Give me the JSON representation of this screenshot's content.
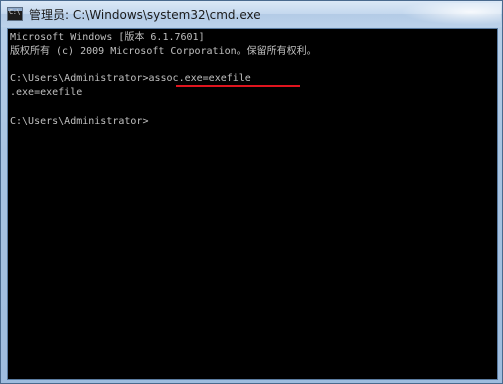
{
  "window": {
    "title": "管理员: C:\\Windows\\system32\\cmd.exe",
    "icon": "cmd-console-icon",
    "icon_label": "C:\\"
  },
  "console": {
    "lines": [
      "Microsoft Windows [版本 6.1.7601]",
      "版权所有 (c) 2009 Microsoft Corporation。保留所有权利。",
      "C:\\Users\\Administrator>assoc.exe=exefile",
      ".exe=exefile",
      "C:\\Users\\Administrator>"
    ]
  },
  "colors": {
    "console_bg": "#000000",
    "console_text": "#c0c0c0",
    "highlight_underline": "#e0141e"
  }
}
